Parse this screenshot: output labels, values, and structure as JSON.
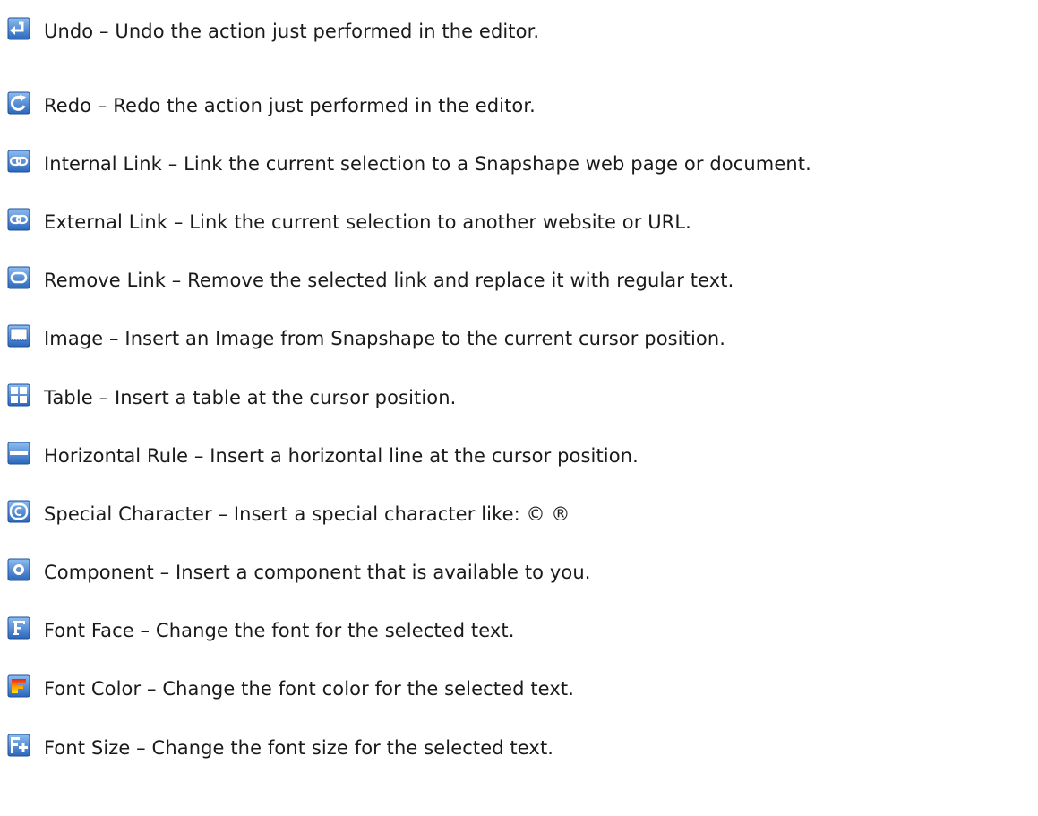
{
  "items": [
    {
      "icon": "undo-icon",
      "text": "Undo – Undo the action just performed in the editor."
    },
    {
      "icon": "redo-icon",
      "text": "Redo – Redo the action just performed in the editor."
    },
    {
      "icon": "internal-link-icon",
      "text": "Internal Link – Link the current selection to a Snapshape web page or document."
    },
    {
      "icon": "external-link-icon",
      "text": "External Link – Link the current selection to another website or URL."
    },
    {
      "icon": "remove-link-icon",
      "text": "Remove Link – Remove the selected link and replace it with regular text."
    },
    {
      "icon": "image-icon",
      "text": "Image – Insert an Image from Snapshape to the current cursor position."
    },
    {
      "icon": "table-icon",
      "text": "Table – Insert a table at the cursor position."
    },
    {
      "icon": "horizontal-rule-icon",
      "text": "Horizontal Rule – Insert a horizontal line at the cursor position."
    },
    {
      "icon": "special-character-icon",
      "text": "Special Character – Insert a special character like: © ®"
    },
    {
      "icon": "component-icon",
      "text": "Component – Insert a component that is available to you."
    },
    {
      "icon": "font-face-icon",
      "text": "Font Face – Change the font for the selected text."
    },
    {
      "icon": "font-color-icon",
      "text": "Font Color – Change the font color for the selected text."
    },
    {
      "icon": "font-size-icon",
      "text": "Font Size – Change the font size for the selected text."
    }
  ],
  "colors": {
    "icon_blue": "#2b6fc7",
    "icon_blue_light": "#7fb0ea",
    "text": "#1a1a1a"
  }
}
